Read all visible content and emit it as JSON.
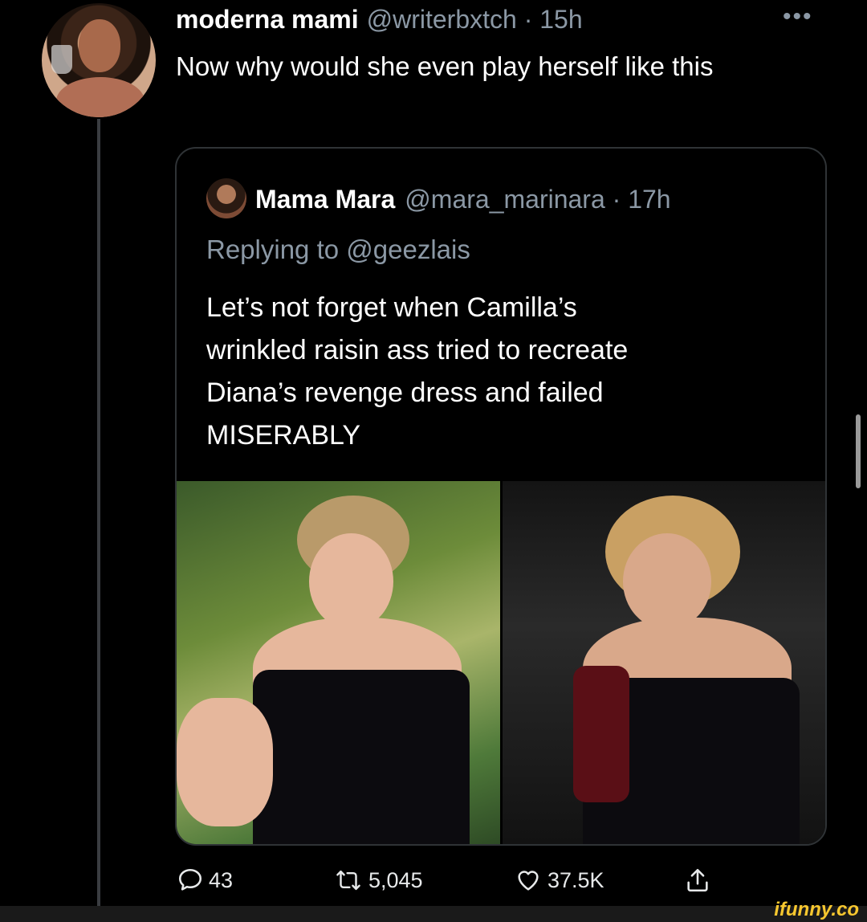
{
  "tweet": {
    "author_name": "moderna mami",
    "meta": "@writerbxtch · 15h",
    "text": "Now why would she even play herself like this"
  },
  "quoted": {
    "author_name": "Mama Mara",
    "meta": "@mara_marinara · 17h",
    "replying": "Replying to @geezlais",
    "text_lines": [
      "Let’s not forget when Camilla’s",
      "wrinkled raisin ass tried to recreate",
      "Diana’s revenge dress and failed",
      "MISERABLY"
    ]
  },
  "actions": {
    "reply_count": "43",
    "retweet_count": "5,045",
    "like_count": "37.5K"
  },
  "watermark": "ifunny.co",
  "icons": [
    "more-icon",
    "reply-icon",
    "retweet-icon",
    "like-icon",
    "share-icon"
  ]
}
